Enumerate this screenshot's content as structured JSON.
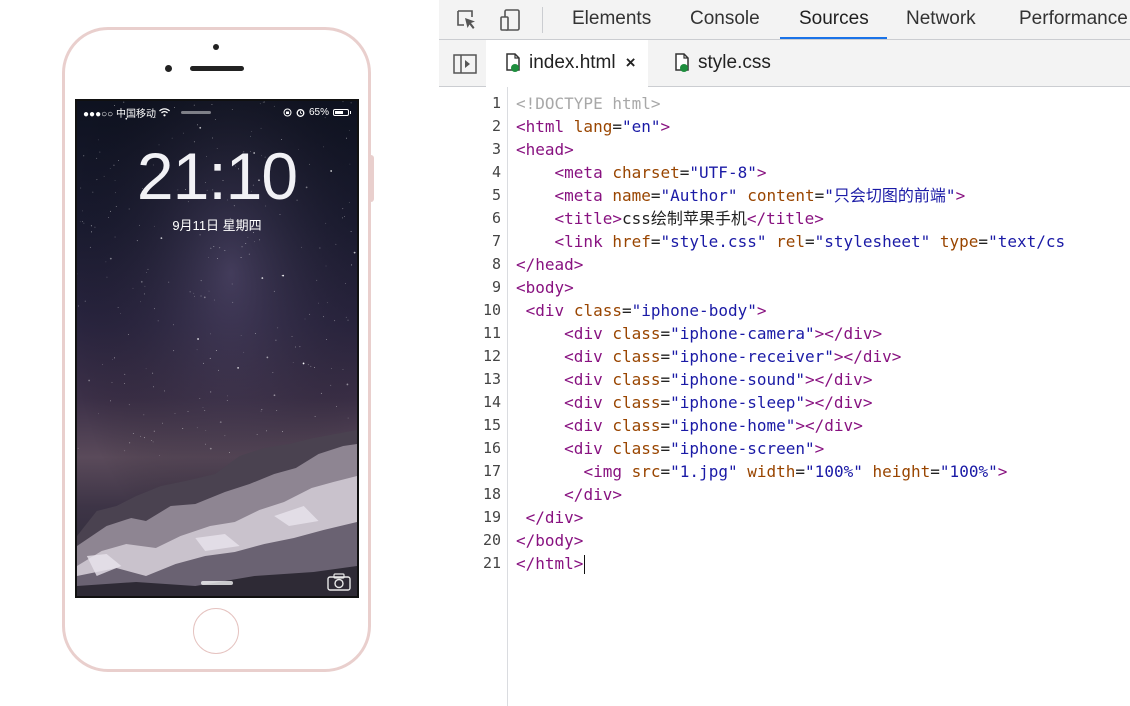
{
  "phone": {
    "status": {
      "carrier": "●●●○○ 中国移动",
      "battery": "65%"
    },
    "lock_time": "21:10",
    "lock_date": "9月11日 星期四"
  },
  "devtools": {
    "tabs": [
      "Elements",
      "Console",
      "Sources",
      "Network",
      "Performance"
    ],
    "active_tab": "Sources",
    "file_tabs": [
      {
        "name": "index.html",
        "close": "×"
      },
      {
        "name": "style.css"
      }
    ],
    "code": {
      "lines": [
        [
          [
            "doctype",
            "<!DOCTYPE html>"
          ]
        ],
        [
          [
            "tag",
            "<html "
          ],
          [
            "attr",
            "lang"
          ],
          [
            "txt",
            "="
          ],
          [
            "val",
            "\"en\""
          ],
          [
            "tag",
            ">"
          ]
        ],
        [
          [
            "tag",
            "<head>"
          ]
        ],
        [
          [
            "txt",
            "    "
          ],
          [
            "tag",
            "<meta "
          ],
          [
            "attr",
            "charset"
          ],
          [
            "txt",
            "="
          ],
          [
            "val",
            "\"UTF-8\""
          ],
          [
            "tag",
            ">"
          ]
        ],
        [
          [
            "txt",
            "    "
          ],
          [
            "tag",
            "<meta "
          ],
          [
            "attr",
            "name"
          ],
          [
            "txt",
            "="
          ],
          [
            "val",
            "\"Author\""
          ],
          [
            "txt",
            " "
          ],
          [
            "attr",
            "content"
          ],
          [
            "txt",
            "="
          ],
          [
            "val",
            "\"只会切图的前端\""
          ],
          [
            "tag",
            ">"
          ]
        ],
        [
          [
            "txt",
            "    "
          ],
          [
            "tag",
            "<title>"
          ],
          [
            "txt",
            "css绘制苹果手机"
          ],
          [
            "tag",
            "</title>"
          ]
        ],
        [
          [
            "txt",
            "    "
          ],
          [
            "tag",
            "<link "
          ],
          [
            "attr",
            "href"
          ],
          [
            "txt",
            "="
          ],
          [
            "val",
            "\"style.css\""
          ],
          [
            "txt",
            " "
          ],
          [
            "attr",
            "rel"
          ],
          [
            "txt",
            "="
          ],
          [
            "val",
            "\"stylesheet\""
          ],
          [
            "txt",
            " "
          ],
          [
            "attr",
            "type"
          ],
          [
            "txt",
            "="
          ],
          [
            "val",
            "\"text/cs"
          ]
        ],
        [
          [
            "tag",
            "</head>"
          ]
        ],
        [
          [
            "tag",
            "<body>"
          ]
        ],
        [
          [
            "txt",
            " "
          ],
          [
            "tag",
            "<div "
          ],
          [
            "attr",
            "class"
          ],
          [
            "txt",
            "="
          ],
          [
            "val",
            "\"iphone-body\""
          ],
          [
            "tag",
            ">"
          ]
        ],
        [
          [
            "txt",
            "     "
          ],
          [
            "tag",
            "<div "
          ],
          [
            "attr",
            "class"
          ],
          [
            "txt",
            "="
          ],
          [
            "val",
            "\"iphone-camera\""
          ],
          [
            "tag",
            "></div>"
          ]
        ],
        [
          [
            "txt",
            "     "
          ],
          [
            "tag",
            "<div "
          ],
          [
            "attr",
            "class"
          ],
          [
            "txt",
            "="
          ],
          [
            "val",
            "\"iphone-receiver\""
          ],
          [
            "tag",
            "></div>"
          ]
        ],
        [
          [
            "txt",
            "     "
          ],
          [
            "tag",
            "<div "
          ],
          [
            "attr",
            "class"
          ],
          [
            "txt",
            "="
          ],
          [
            "val",
            "\"iphone-sound\""
          ],
          [
            "tag",
            "></div>"
          ]
        ],
        [
          [
            "txt",
            "     "
          ],
          [
            "tag",
            "<div "
          ],
          [
            "attr",
            "class"
          ],
          [
            "txt",
            "="
          ],
          [
            "val",
            "\"iphone-sleep\""
          ],
          [
            "tag",
            "></div>"
          ]
        ],
        [
          [
            "txt",
            "     "
          ],
          [
            "tag",
            "<div "
          ],
          [
            "attr",
            "class"
          ],
          [
            "txt",
            "="
          ],
          [
            "val",
            "\"iphone-home\""
          ],
          [
            "tag",
            "></div>"
          ]
        ],
        [
          [
            "txt",
            "     "
          ],
          [
            "tag",
            "<div "
          ],
          [
            "attr",
            "class"
          ],
          [
            "txt",
            "="
          ],
          [
            "val",
            "\"iphone-screen\""
          ],
          [
            "tag",
            ">"
          ]
        ],
        [
          [
            "txt",
            "       "
          ],
          [
            "tag",
            "<img "
          ],
          [
            "attr",
            "src"
          ],
          [
            "txt",
            "="
          ],
          [
            "val",
            "\"1.jpg\""
          ],
          [
            "txt",
            " "
          ],
          [
            "attr",
            "width"
          ],
          [
            "txt",
            "="
          ],
          [
            "val",
            "\"100%\""
          ],
          [
            "txt",
            " "
          ],
          [
            "attr",
            "height"
          ],
          [
            "txt",
            "="
          ],
          [
            "val",
            "\"100%\""
          ],
          [
            "tag",
            ">"
          ]
        ],
        [
          [
            "txt",
            "     "
          ],
          [
            "tag",
            "</div>"
          ]
        ],
        [
          [
            "txt",
            " "
          ],
          [
            "tag",
            "</div>"
          ]
        ],
        [
          [
            "tag",
            "</body>"
          ]
        ],
        [
          [
            "tag",
            "</html>"
          ]
        ]
      ]
    }
  }
}
